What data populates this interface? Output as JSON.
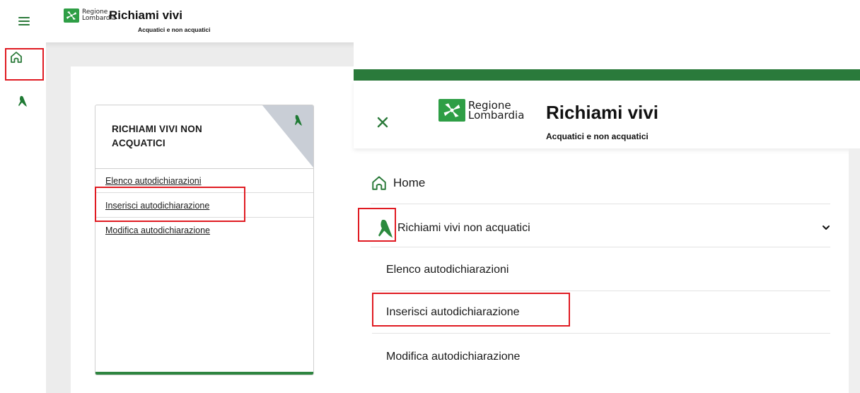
{
  "app": {
    "logo_line1": "Regione",
    "logo_line2": "Lombardia",
    "title": "Richiami vivi",
    "subtitle": "Acquatici e non acquatici"
  },
  "card": {
    "title_line1": "RICHIAMI VIVI NON",
    "title_line2": "ACQUATICI",
    "links": [
      "Elenco autodichiarazioni",
      "Inserisci autodichiarazione",
      "Modifica autodichiarazione"
    ]
  },
  "menu": {
    "home_label": "Home",
    "section_label": "Richiami vivi non acquatici",
    "sub_items": [
      "Elenco autodichiarazioni",
      "Inserisci autodichiarazione",
      "Modifica autodichiarazione"
    ]
  },
  "icons": {
    "hamburger": "menu-icon",
    "home": "home-icon",
    "bird": "bird-icon",
    "close": "close-icon",
    "chevron": "chevron-down-icon"
  },
  "colors": {
    "brand_green": "#2e9e45",
    "dark_green": "#2a7a3b",
    "highlight_red": "#e01b22",
    "corner_gray": "#c9ced6"
  }
}
